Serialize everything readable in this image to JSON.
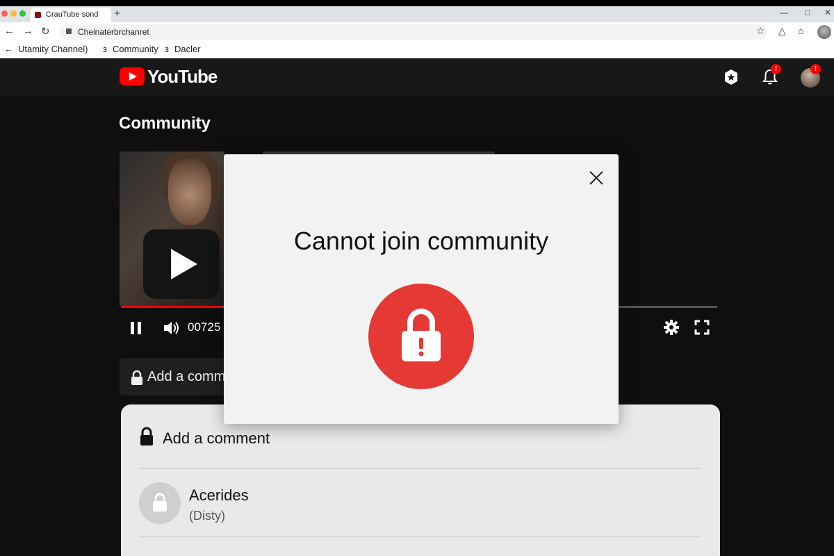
{
  "browser": {
    "tab_title": "CrauTube sond",
    "new_tab": "+",
    "url": "Cheinaterbrchanret",
    "bookmarks": [
      "Utamity Channel)",
      "Community",
      "Dacler"
    ],
    "bookmark_sep": "з"
  },
  "header": {
    "logo_text": "YouTube",
    "notif_badge": "!",
    "avatar_badge": "!"
  },
  "page": {
    "title": "Community"
  },
  "player": {
    "time": "00725",
    "progress": 0.17
  },
  "mini_comment": {
    "label": "Add a comment"
  },
  "comments": {
    "add_label": "Add a comment",
    "items": [
      {
        "name": "Acerides",
        "sub": "(Disty)"
      }
    ]
  },
  "modal": {
    "title": "Cannot join community",
    "icon": "lock-alert-icon",
    "accent": "#e53935"
  },
  "colors": {
    "brand": "#ff0000",
    "dark_bg": "#0f0f0f"
  }
}
